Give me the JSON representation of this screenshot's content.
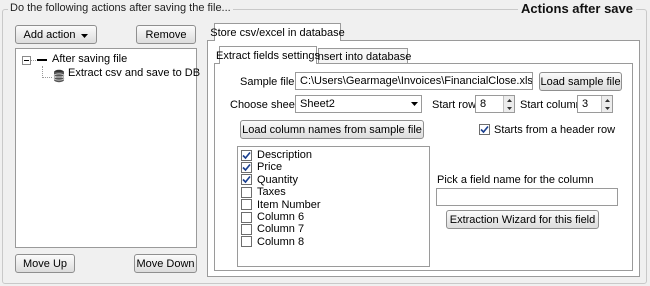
{
  "group_legend": "Do the following actions after saving the file...",
  "header_title": "Actions after save",
  "left": {
    "add_action": "Add action",
    "remove": "Remove",
    "tree_root": "After saving file",
    "tree_child": "Extract csv and save to DB",
    "move_up": "Move Up",
    "move_down": "Move Down"
  },
  "outer_tab": "Store csv/excel in database",
  "inner_tabs": [
    "Extract fields settings",
    "Insert into database"
  ],
  "form": {
    "sample_file_label": "Sample file",
    "sample_file_value": "C:\\Users\\Gearmage\\Invoices\\FinancialClose.xlsx",
    "load_sample_btn": "Load sample file",
    "choose_sheet_label": "Choose sheet",
    "sheet_value": "Sheet2",
    "start_row_label": "Start row",
    "start_row_value": "8",
    "start_col_label": "Start column",
    "start_col_value": "3",
    "load_columns_btn": "Load column names from sample file",
    "header_row_label": "Starts from a header row",
    "header_row_checked": true,
    "pick_field_label": "Pick a field name for the column",
    "pick_field_value": "",
    "wizard_btn": "Extraction Wizard for this field"
  },
  "columns": [
    {
      "label": "Description",
      "checked": true
    },
    {
      "label": "Price",
      "checked": true
    },
    {
      "label": "Quantity",
      "checked": true
    },
    {
      "label": "Taxes",
      "checked": false
    },
    {
      "label": "Item Number",
      "checked": false
    },
    {
      "label": "Column 6",
      "checked": false
    },
    {
      "label": "Column 7",
      "checked": false
    },
    {
      "label": "Column 8",
      "checked": false
    }
  ]
}
